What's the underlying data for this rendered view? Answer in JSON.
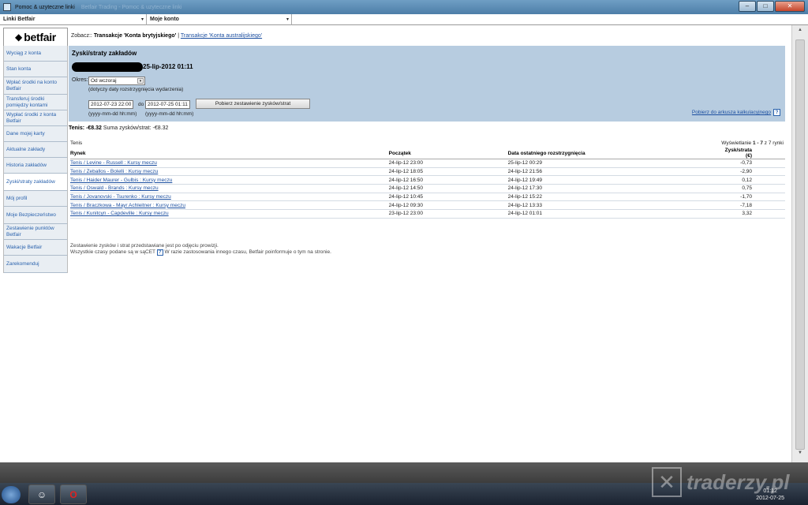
{
  "window": {
    "title": "Pomoc & uzyteczne linki",
    "ghost_title": "Betfair Trading - Pomoc & uzyteczne linki",
    "buttons": {
      "minimize": "–",
      "maximize": "□",
      "close": "✕"
    }
  },
  "dropdowns": {
    "links": "Linki Betfair",
    "account": "Moje konto",
    "arrow": "▾"
  },
  "logo": {
    "mark": "◆",
    "text": "betfair"
  },
  "zobacz": {
    "prefix": "Zobacz::",
    "current": "Transakcje 'Konta brytyjskiego'",
    "separator": "|",
    "link": "Transakcje 'Konta australijskiego'"
  },
  "sidebar": {
    "items": [
      {
        "label": "Wyciąg z konta"
      },
      {
        "label": "Stan konta"
      },
      {
        "label": "Wpłać środki na konto Betfair"
      },
      {
        "label": "Transferuj środki pomiędzy kontami"
      },
      {
        "label": "Wypłać środki z konta Betfair"
      },
      {
        "label": "Dane mojej karty"
      },
      {
        "label": "Aktualne zakłady"
      },
      {
        "label": "Historia zakładów"
      },
      {
        "label": "Zyski/straty zakładów"
      },
      {
        "label": "Mój profil"
      },
      {
        "label": "Moje Bezpieczeństwo"
      },
      {
        "label": "Zestawienie punktów Betfair"
      },
      {
        "label": "Wakacje Betfair"
      },
      {
        "label": "Zarekomenduj"
      }
    ]
  },
  "filters": {
    "heading": "Zyski/straty zakładów",
    "date": "25-lip-2012 01:11",
    "okres_label": "Okres:",
    "okres_value": "Od wczoraj",
    "okres_note": "(dotyczy daty rozstrzygnięcia wydarzenia)",
    "from_value": "2012-07-23 22:00",
    "to_label": "do",
    "to_value": "2012-07-25 01:11",
    "format_hint": "(yyyy-mm-dd hh:mm)",
    "submit": "Pobierz zestawienie zysków/strat",
    "download": "Pobierz do arkusza kalkulacyjnego",
    "help": "?"
  },
  "summary": {
    "sport_label": "Tenis:",
    "sport_value": "-€8.32",
    "total_label": "Suma zysków/strat:",
    "total_value": "-€8.32"
  },
  "table": {
    "sport": "Tenis",
    "count_prefix": "Wyświetlanie",
    "count_range": "1 - 7",
    "count_suffix": "z 7 rynki",
    "headers": [
      "Rynek",
      "Początek",
      "Data ostatniego rozstrzygnięcia",
      "Zysk/strata (€)"
    ],
    "rows": [
      {
        "market": "Tenis / Levine - Russell : Kursy meczu",
        "start": "24-lip-12 23:00",
        "settled": "25-lip-12 00:29",
        "pl": "-0,73"
      },
      {
        "market": "Tenis / Zeballos - Bolelli : Kursy meczu",
        "start": "24-lip-12 18:05",
        "settled": "24-lip-12 21:56",
        "pl": "-2,90"
      },
      {
        "market": "Tenis / Haider Maurer - Gulbis : Kursy meczu",
        "start": "24-lip-12 16:50",
        "settled": "24-lip-12 19:49",
        "pl": "0,12"
      },
      {
        "market": "Tenis / Oswald - Brands : Kursy meczu",
        "start": "24-lip-12 14:50",
        "settled": "24-lip-12 17:30",
        "pl": "0,75"
      },
      {
        "market": "Tenis / Jovanovski - Tsurenko : Kursy meczu",
        "start": "24-lip-12 10:45",
        "settled": "24-lip-12 15:22",
        "pl": "-1,70"
      },
      {
        "market": "Tenis / Braczkowa - Mayr Achleitner : Kursy meczu",
        "start": "24-lip-12 09:30",
        "settled": "24-lip-12 13:33",
        "pl": "-7,18"
      },
      {
        "market": "Tenis / Kunitcyn - Capdeville : Kursy meczu",
        "start": "23-lip-12 23:00",
        "settled": "24-lip-12 01:01",
        "pl": "3,32"
      }
    ]
  },
  "footnotes": {
    "line1": "Zestawienie zysków i strat przedstawiane jest po odjęciu prowizji.",
    "line2_a": "Wszystkie czasy podane są w sąCET",
    "line2_b": "W razie zastosowania innego czasu, Betfair poinformuje o tym na stronie."
  },
  "scroll": {
    "up": "▲",
    "down": "▼"
  },
  "taskbar": {
    "app2": "☺",
    "app3": "O"
  },
  "watermark": {
    "box": "✕",
    "text": "traderzy.pl"
  },
  "clock": {
    "time": "01:12",
    "date": "2012-07-25"
  }
}
